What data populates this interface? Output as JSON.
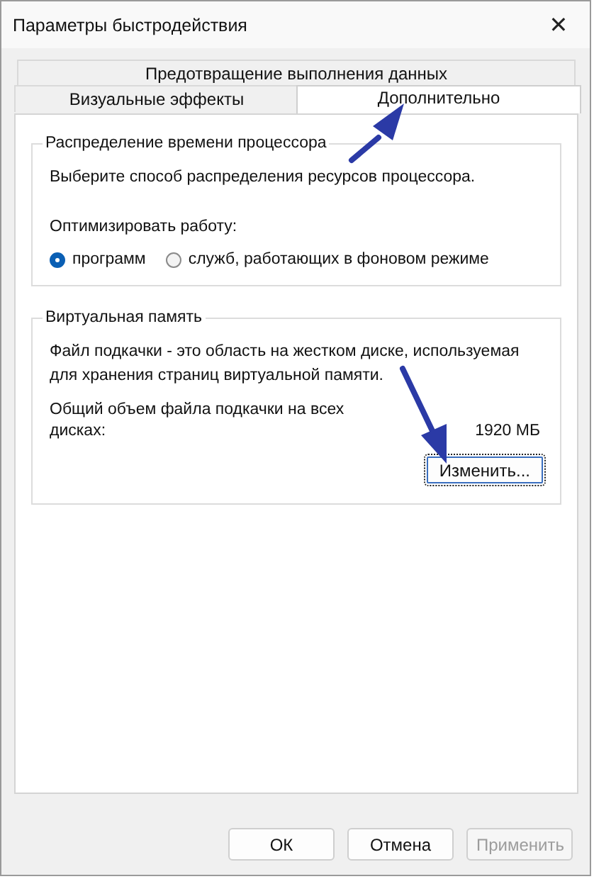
{
  "window": {
    "title": "Параметры быстродействия",
    "close": "✕"
  },
  "tab_rows": [
    [
      {
        "label": "Предотвращение выполнения данных",
        "selected": false
      }
    ],
    [
      {
        "label": "Визуальные эффекты",
        "selected": false
      },
      {
        "label": "Дополнительно",
        "selected": true
      }
    ]
  ],
  "cpu_group": {
    "title": "Распределение времени процессора",
    "description": "Выберите способ распределения ресурсов процессора.",
    "optimize_label": "Оптимизировать работу:",
    "options": [
      {
        "label": "программ",
        "selected": true
      },
      {
        "label": "служб, работающих в фоновом режиме",
        "selected": false
      }
    ]
  },
  "memory_group": {
    "title": "Виртуальная память",
    "description": "Файл подкачки - это область на жестком диске, используемая для хранения страниц виртуальной памяти.",
    "total_label": "Общий объем файла подкачки на всех дисках:",
    "total_value": "1920 МБ",
    "change_button": "Изменить..."
  },
  "buttons": [
    {
      "label": "ОК",
      "disabled": false
    },
    {
      "label": "Отмена",
      "disabled": false
    },
    {
      "label": "Применить",
      "disabled": true
    }
  ]
}
